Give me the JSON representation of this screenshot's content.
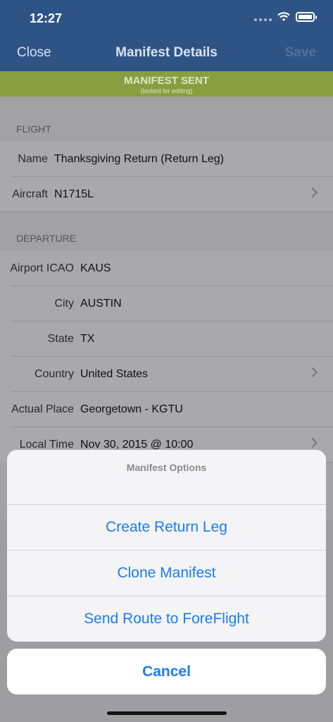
{
  "status": {
    "time": "12:27"
  },
  "nav": {
    "close_label": "Close",
    "title": "Manifest Details",
    "save_label": "Save"
  },
  "banner": {
    "title": "MANIFEST SENT",
    "subtitle": "(locked for editing)"
  },
  "flight": {
    "header": "FLIGHT",
    "name_label": "Name",
    "name_value": "Thanksgiving Return (Return Leg)",
    "aircraft_label": "Aircraft",
    "aircraft_value": "N1715L"
  },
  "departure": {
    "header": "DEPARTURE",
    "icao_label": "Airport ICAO",
    "icao_value": "KAUS",
    "city_label": "City",
    "city_value": "AUSTIN",
    "state_label": "State",
    "state_value": "TX",
    "country_label": "Country",
    "country_value": "United States",
    "place_label": "Actual Place",
    "place_value": "Georgetown - KGTU",
    "time_label": "Local Time",
    "time_value": "Nov 30, 2015 @ 10:00"
  },
  "sheet": {
    "title": "Manifest Options",
    "create_return": "Create Return Leg",
    "clone": "Clone Manifest",
    "send_route": "Send Route to ForeFlight",
    "cancel": "Cancel"
  },
  "colors": {
    "nav_bg": "#2e5486",
    "banner_bg": "#879f3f",
    "accent": "#1a7cf5"
  }
}
